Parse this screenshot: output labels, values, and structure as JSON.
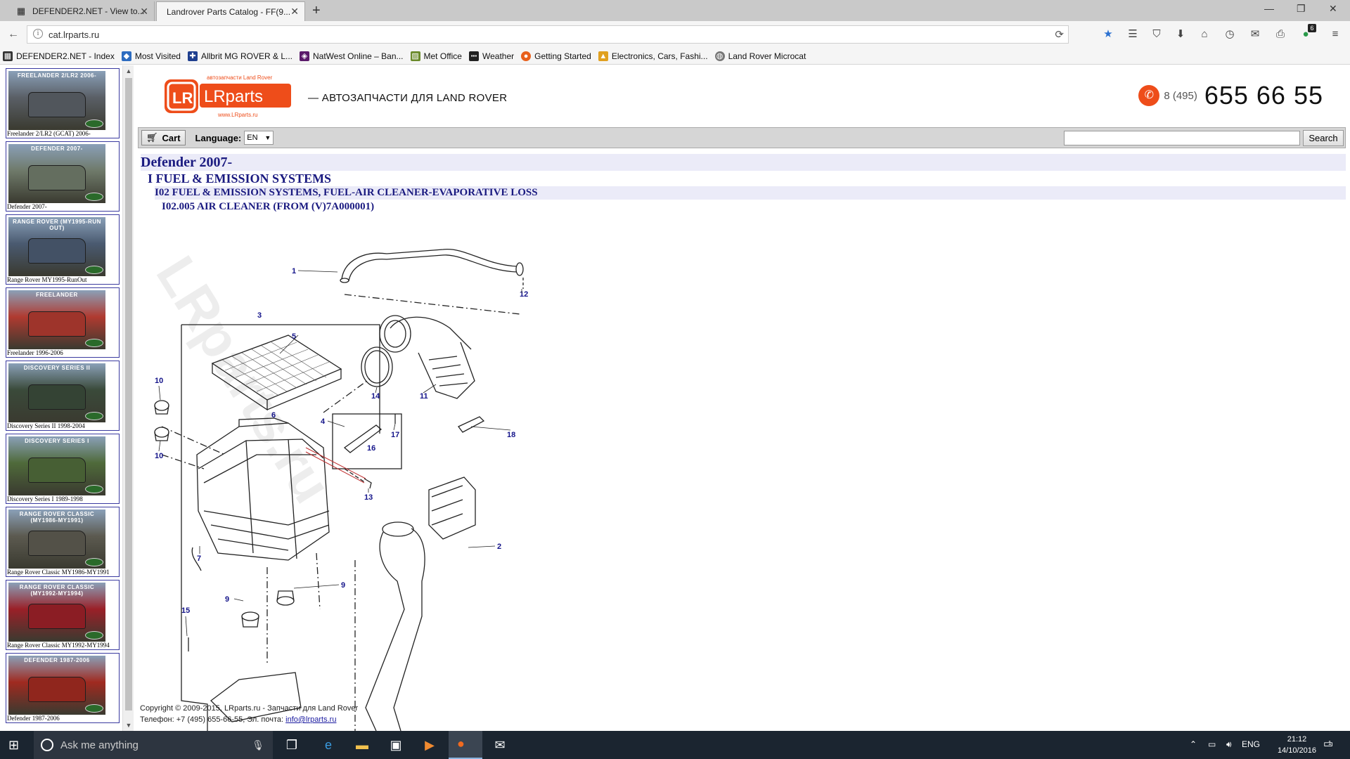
{
  "browser": {
    "tabs": [
      {
        "label": "DEFENDER2.NET - View to...",
        "active": false
      },
      {
        "label": "Landrover Parts Catalog - FF(9...",
        "active": true
      }
    ],
    "url": "cat.lrparts.ru",
    "badge_count": "6"
  },
  "bookmarks": [
    {
      "label": "DEFENDER2.NET - Index",
      "color": "#333333",
      "icon": "d2-icon"
    },
    {
      "label": "Most Visited",
      "color": "#2d6cc0",
      "icon": "most-visited-icon"
    },
    {
      "label": "Allbrit MG ROVER & L...",
      "color": "#1f3f8f",
      "icon": "uk-flag-icon"
    },
    {
      "label": "NatWest Online – Ban...",
      "color": "#5a1a6a",
      "icon": "natwest-icon"
    },
    {
      "label": "Met Office",
      "color": "#6a8a2a",
      "icon": "met-office-icon"
    },
    {
      "label": "Weather",
      "color": "#222222",
      "icon": "bbc-icon"
    },
    {
      "label": "Getting Started",
      "color": "#e8601c",
      "icon": "firefox-icon"
    },
    {
      "label": "Electronics, Cars, Fashi...",
      "color": "#e0a020",
      "icon": "ebay-icon"
    },
    {
      "label": "Land Rover Microcat",
      "color": "#777777",
      "icon": "globe-icon"
    }
  ],
  "sidebar": {
    "models": [
      {
        "title": "FREELANDER 2/LR2 2006-",
        "caption": "Freelander 2/LR2 (GCAT) 2006-",
        "color": "#5a5f66"
      },
      {
        "title": "DEFENDER 2007-",
        "caption": "Defender 2007-",
        "color": "#6f7a6a"
      },
      {
        "title": "RANGE ROVER (MY1995-RUN OUT)",
        "caption": "Range Rover MY1995-RunOut",
        "color": "#4a5a70"
      },
      {
        "title": "FREELANDER",
        "caption": "Freelander 1996-2006",
        "color": "#b03a30"
      },
      {
        "title": "DISCOVERY SERIES II",
        "caption": "Discovery Series II 1998-2004",
        "color": "#3a4a3a"
      },
      {
        "title": "DISCOVERY SERIES I",
        "caption": "Discovery Series I 1989-1998",
        "color": "#4f6a3a"
      },
      {
        "title": "RANGE ROVER CLASSIC (MY1986-MY1991)",
        "caption": "Range Rover Classic MY1986-MY1991",
        "color": "#5c5a50"
      },
      {
        "title": "RANGE ROVER CLASSIC (MY1992-MY1994)",
        "caption": "Range Rover Classic MY1992-MY1994",
        "color": "#9a2028"
      },
      {
        "title": "DEFENDER 1987-2006",
        "caption": "Defender 1987-2006",
        "color": "#a02a20"
      }
    ]
  },
  "header": {
    "logo_small_top": "автозапчасти Land Rover",
    "logo_text": "LRparts",
    "logo_small_bottom": "www.LRparts.ru",
    "tagline": "— АВТОЗАПЧАСТИ ДЛЯ LAND ROVER",
    "phone_code": "8 (495)",
    "phone_number": "655 66 55",
    "accent": "#ee4d1a"
  },
  "toolbar": {
    "cart_label": "Cart",
    "language_label": "Language:",
    "language_value": "EN",
    "search_value": "",
    "search_label": "Search"
  },
  "breadcrumb": {
    "level1": "Defender 2007-",
    "level2": "I FUEL & EMISSION SYSTEMS",
    "level3": "I02 FUEL & EMISSION SYSTEMS, FUEL-AIR CLEANER-EVAPORATIVE LOSS",
    "level4": "I02.005 AIR CLEANER (FROM (V)7A000001)"
  },
  "diagram": {
    "watermark": "LRparts.ru",
    "callouts": [
      "1",
      "12",
      "3",
      "5",
      "10",
      "14",
      "11",
      "6",
      "4",
      "17",
      "16",
      "18",
      "10",
      "13",
      "2",
      "7",
      "9",
      "9",
      "15"
    ]
  },
  "footer": {
    "copyright": "Copyright © 2009-2015, LRparts.ru - Запчасти для Land Rover",
    "contact_prefix": "Телефон: +7 (495) 655-66-55, Эл. почта:",
    "email": "info@lrparts.ru"
  },
  "taskbar": {
    "search_placeholder": "Ask me anything",
    "language": "ENG",
    "time": "21:12",
    "date": "14/10/2016",
    "notif_count": "1"
  }
}
